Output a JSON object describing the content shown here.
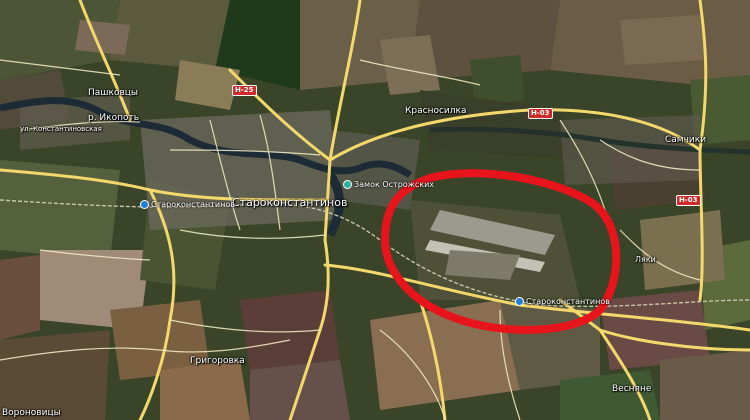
{
  "map": {
    "colors": {
      "road_major": "#f3d86b",
      "road_minor": "#f7f1c8",
      "river": "#1c2b36",
      "highlight_circle": "#e8141c",
      "highway_shield": "#cf2a2a",
      "railway_station": "#1e7fd6",
      "poi": "#2bb39a"
    },
    "labels": {
      "paschvtsi": "Пашковцы",
      "river_ikopot": "р. Икопоть",
      "street_left": "ул. Константиновская",
      "city": "Староконстантинов",
      "station_west": "Староконстантинов",
      "castle": "Замок Острожских",
      "station_east": "Староконстантинов",
      "krasnosilka": "Красносилка",
      "samets": "Самчики",
      "hryhorivka": "Григоровка",
      "voronkovtsi": "Вороновицы",
      "vesnyane": "Весняне",
      "lnyaki": "Ляки"
    },
    "shields": {
      "h1": "H-25",
      "h2": "H-03",
      "h3": "H-03"
    }
  }
}
